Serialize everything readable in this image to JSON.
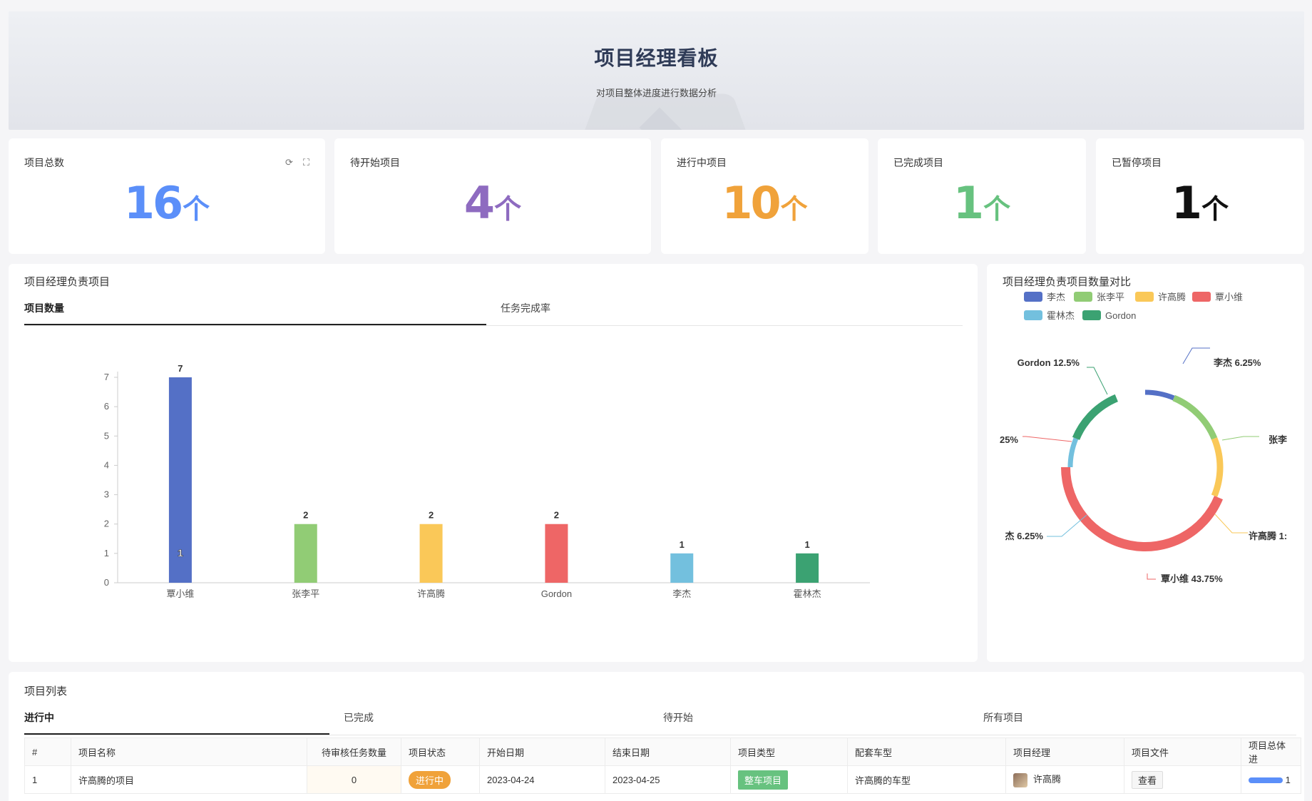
{
  "header": {
    "title": "项目经理看板",
    "subtitle": "对项目整体进度进行数据分析"
  },
  "stats": [
    {
      "label": "项目总数",
      "value": "16",
      "unit": "个",
      "color": "#5b8ff9"
    },
    {
      "label": "待开始项目",
      "value": "4",
      "unit": "个",
      "color": "#8e6bc0"
    },
    {
      "label": "进行中项目",
      "value": "10",
      "unit": "个",
      "color": "#f0a23a"
    },
    {
      "label": "已完成项目",
      "value": "1",
      "unit": "个",
      "color": "#67c27f"
    },
    {
      "label": "已暂停项目",
      "value": "1",
      "unit": "个",
      "color": "#111111"
    }
  ],
  "bar_section": {
    "title": "项目经理负责项目",
    "tabs": [
      "项目数量",
      "任务完成率"
    ],
    "active_tab": 0
  },
  "pie_section": {
    "title": "项目经理负责项目数量对比"
  },
  "chart_data": [
    {
      "type": "bar",
      "categories": [
        "覃小维",
        "张李平",
        "许高腾",
        "Gordon",
        "李杰",
        "霍林杰"
      ],
      "values": [
        7,
        2,
        2,
        2,
        1,
        1
      ],
      "colors": [
        "#5470c6",
        "#91cc75",
        "#fac858",
        "#ee6666",
        "#73c0de",
        "#3ba272"
      ],
      "inner_label": "1",
      "ylim": [
        0,
        7
      ],
      "yticks": [
        0,
        1,
        2,
        3,
        4,
        5,
        6,
        7
      ],
      "grid": false,
      "title": "",
      "xlabel": "",
      "ylabel": ""
    },
    {
      "type": "pie",
      "donut": true,
      "legend": [
        "李杰",
        "张李平",
        "许高腾",
        "覃小维",
        "霍林杰",
        "Gordon"
      ],
      "legend_position": "top",
      "slices": [
        {
          "name": "李杰",
          "percent": 6.25,
          "color": "#5470c6",
          "label": "李杰 6.25%"
        },
        {
          "name": "张李平",
          "percent": 12.5,
          "color": "#91cc75",
          "label": "张李"
        },
        {
          "name": "许高腾",
          "percent": 12.5,
          "color": "#fac858",
          "label": "许高腾 1:"
        },
        {
          "name": "覃小维",
          "percent": 43.75,
          "color": "#ee6666",
          "label": "覃小维 43.75%"
        },
        {
          "name": "霍林杰",
          "percent": 6.25,
          "color": "#73c0de",
          "label": "杰 6.25%"
        },
        {
          "name": "Gordon",
          "percent": 12.5,
          "color": "#3ba272",
          "label": "Gordon 12.5%"
        }
      ],
      "extra_label": "25%"
    }
  ],
  "list_section": {
    "title": "项目列表",
    "tabs": [
      "进行中",
      "已完成",
      "待开始",
      "所有项目"
    ],
    "active_tab": 0,
    "columns": [
      "#",
      "项目名称",
      "待审核任务数量",
      "项目状态",
      "开始日期",
      "结束日期",
      "项目类型",
      "配套车型",
      "项目经理",
      "项目文件",
      "项目总体进"
    ],
    "rows": [
      {
        "index": "1",
        "name": "许高腾的项目",
        "pending": "0",
        "status": "进行中",
        "start": "2023-04-24",
        "end": "2023-04-25",
        "type": "整车项目",
        "model": "许高腾的车型",
        "manager": "许高腾",
        "file": "查看",
        "progress": "1"
      }
    ]
  }
}
